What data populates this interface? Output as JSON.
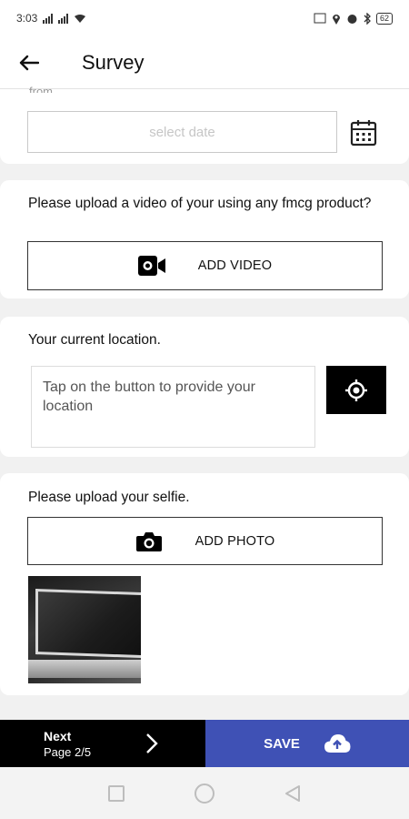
{
  "status_bar": {
    "time": "3:03",
    "battery": "62"
  },
  "app_bar": {
    "title": "Survey"
  },
  "date_section": {
    "cut_label": "from",
    "placeholder": "select date"
  },
  "video_section": {
    "question": "Please upload a video of your using any fmcg product?",
    "button_label": "ADD VIDEO"
  },
  "location_section": {
    "question": "Your current location.",
    "hint": "Tap on the button to provide your location"
  },
  "selfie_section": {
    "question": "Please upload your selfie.",
    "button_label": "ADD PHOTO"
  },
  "bottom_bar": {
    "next_label": "Next",
    "page_indicator": "Page 2/5",
    "save_label": "SAVE"
  },
  "colors": {
    "save_button": "#3f51b5",
    "next_button": "#000000",
    "background": "#f1f1f1"
  },
  "icons": {
    "back": "arrow-left-icon",
    "calendar": "calendar-icon",
    "video": "video-camera-icon",
    "locate": "gps-target-icon",
    "camera": "camera-icon",
    "next": "chevron-right-icon",
    "save": "cloud-upload-icon"
  }
}
